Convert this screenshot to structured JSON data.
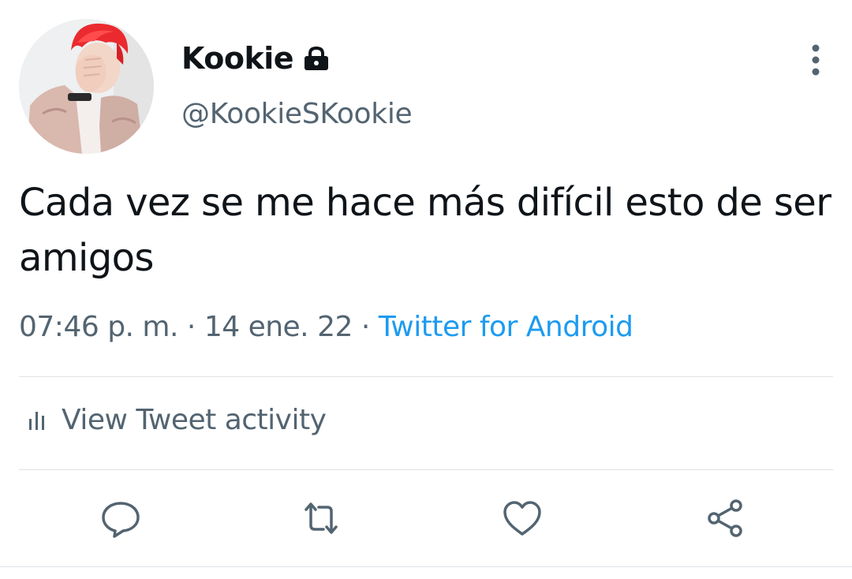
{
  "user": {
    "display_name": "Kookie",
    "handle": "@KookieSKookie",
    "avatar_icon": "profile-photo",
    "protected_icon": "lock-icon"
  },
  "tweet": {
    "text": "Cada vez se me hace más difícil esto de ser amigos",
    "time": "07:46 p. m.",
    "separator": "·",
    "date": "14 ene. 22",
    "source": "Twitter for Android"
  },
  "activity": {
    "label": "View Tweet activity",
    "icon": "bar-chart-icon"
  },
  "actions": [
    {
      "name": "reply",
      "icon": "reply-icon"
    },
    {
      "name": "retweet",
      "icon": "retweet-icon"
    },
    {
      "name": "like",
      "icon": "heart-icon"
    },
    {
      "name": "share",
      "icon": "share-icon"
    }
  ],
  "colors": {
    "text_primary": "#0f1419",
    "text_secondary": "#536471",
    "link": "#1d9bf0",
    "divider": "#dfe3e6"
  }
}
